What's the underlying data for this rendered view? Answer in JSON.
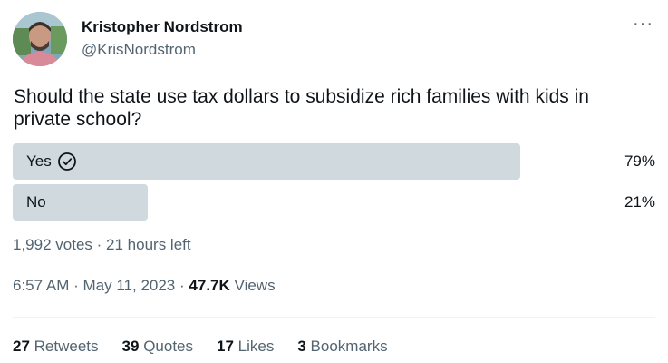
{
  "author": {
    "name": "Kristopher Nordstrom",
    "handle": "@KrisNordstrom"
  },
  "more_glyph": "···",
  "question": "Should the state use tax dollars to subsidize rich families with kids in private school?",
  "poll": {
    "options": [
      {
        "label": "Yes",
        "percent_text": "79%",
        "percent": 79,
        "selected": true
      },
      {
        "label": "No",
        "percent_text": "21%",
        "percent": 21,
        "selected": false
      }
    ],
    "votes": "1,992 votes",
    "time_left": "21 hours left",
    "separator": "·"
  },
  "timestamp": {
    "time": "6:57 AM",
    "date": "May 11, 2023",
    "views_count": "47.7K",
    "views_label": "Views"
  },
  "stats": {
    "retweets_count": "27",
    "retweets_label": "Retweets",
    "quotes_count": "39",
    "quotes_label": "Quotes",
    "likes_count": "17",
    "likes_label": "Likes",
    "bookmarks_count": "3",
    "bookmarks_label": "Bookmarks"
  },
  "colors": {
    "bar": "#cfd9de",
    "secondary_text": "#536471",
    "primary_text": "#0f1419"
  }
}
